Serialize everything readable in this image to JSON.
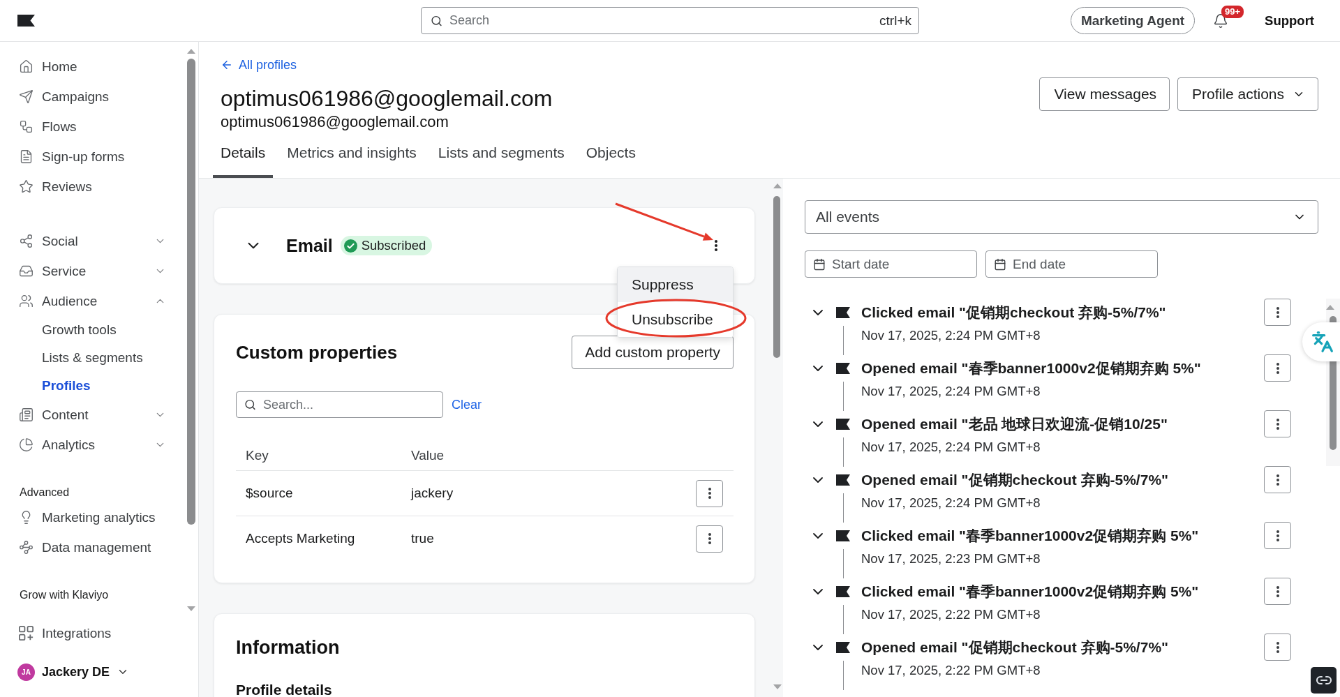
{
  "top_bar": {
    "search": {
      "placeholder": "Search",
      "shortcut": "ctrl+k"
    },
    "agent_button": "Marketing Agent",
    "notification_count": "99+",
    "support_link": "Support"
  },
  "sidebar": {
    "groups": [
      {
        "items": [
          {
            "label": "Home",
            "selected": false
          },
          {
            "label": "Campaigns",
            "selected": false
          },
          {
            "label": "Flows",
            "selected": false
          },
          {
            "label": "Sign-up forms",
            "selected": false
          },
          {
            "label": "Reviews",
            "selected": false
          }
        ]
      },
      {
        "items": [
          {
            "label": "Social",
            "selected": false,
            "expanded": false
          },
          {
            "label": "Service",
            "selected": false,
            "expanded": false
          },
          {
            "label": "Audience",
            "selected": false,
            "expanded": true,
            "children": [
              {
                "label": "Growth tools",
                "selected": false
              },
              {
                "label": "Lists & segments",
                "selected": false
              },
              {
                "label": "Profiles",
                "selected": true
              }
            ]
          },
          {
            "label": "Content",
            "selected": false,
            "expanded": false
          },
          {
            "label": "Analytics",
            "selected": false,
            "expanded": false
          }
        ]
      },
      {
        "heading": "Advanced",
        "items": [
          {
            "label": "Marketing analytics",
            "selected": false
          },
          {
            "label": "Data management",
            "selected": false
          }
        ]
      },
      {
        "heading": "Grow with Klaviyo"
      }
    ],
    "footer_items": [
      {
        "label": "Integrations",
        "selected": false
      }
    ],
    "account": {
      "initials": "JA",
      "name": "Jackery DE"
    }
  },
  "profile": {
    "back_link": "All profiles",
    "title": "optimus061986@googlemail.com",
    "subtitle": "optimus061986@googlemail.com",
    "actions": [
      {
        "label": "View messages",
        "kind": "button"
      },
      {
        "label": "Profile actions",
        "kind": "menu"
      }
    ]
  },
  "tabs": [
    {
      "label": "Details",
      "selected": true
    },
    {
      "label": "Metrics and insights",
      "selected": false
    },
    {
      "label": "Lists and segments",
      "selected": false
    },
    {
      "label": "Objects",
      "selected": false
    }
  ],
  "email_card": {
    "title": "Email",
    "status": "Subscribed",
    "menu": [
      {
        "label": "Suppress",
        "highlighted": true
      },
      {
        "label": "Unsubscribe",
        "highlighted": false
      }
    ]
  },
  "annotations": [
    {
      "kind": "arrow"
    },
    {
      "kind": "ellipse"
    }
  ],
  "custom_properties": {
    "title": "Custom properties",
    "add_button": "Add custom property",
    "search": {
      "placeholder": "Search..."
    },
    "clear_link": "Clear",
    "columns": [
      "Key",
      "Value"
    ],
    "rows": [
      {
        "key": "$source",
        "value": "jackery"
      },
      {
        "key": "Accepts Marketing",
        "value": "true"
      }
    ]
  },
  "information": {
    "title": "Information",
    "section": "Profile details"
  },
  "events": {
    "filter": "All events",
    "start_date": {
      "placeholder": "Start date"
    },
    "end_date": {
      "placeholder": "End date"
    },
    "items": [
      {
        "title": "Clicked email \"促销期checkout 弃购-5%/7%\"",
        "time": "Nov 17, 2025, 2:24 PM GMT+8"
      },
      {
        "title": "Opened email \"春季banner1000v2促销期弃购 5%\"",
        "time": "Nov 17, 2025, 2:24 PM GMT+8"
      },
      {
        "title": "Opened email \"老品 地球日欢迎流-促销10/25\"",
        "time": "Nov 17, 2025, 2:24 PM GMT+8"
      },
      {
        "title": "Opened email \"促销期checkout 弃购-5%/7%\"",
        "time": "Nov 17, 2025, 2:24 PM GMT+8"
      },
      {
        "title": "Clicked email \"春季banner1000v2促销期弃购 5%\"",
        "time": "Nov 17, 2025, 2:23 PM GMT+8"
      },
      {
        "title": "Clicked email \"春季banner1000v2促销期弃购 5%\"",
        "time": "Nov 17, 2025, 2:22 PM GMT+8"
      },
      {
        "title": "Opened email \"促销期checkout 弃购-5%/7%\"",
        "time": "Nov 17, 2025, 2:22 PM GMT+8"
      }
    ]
  }
}
